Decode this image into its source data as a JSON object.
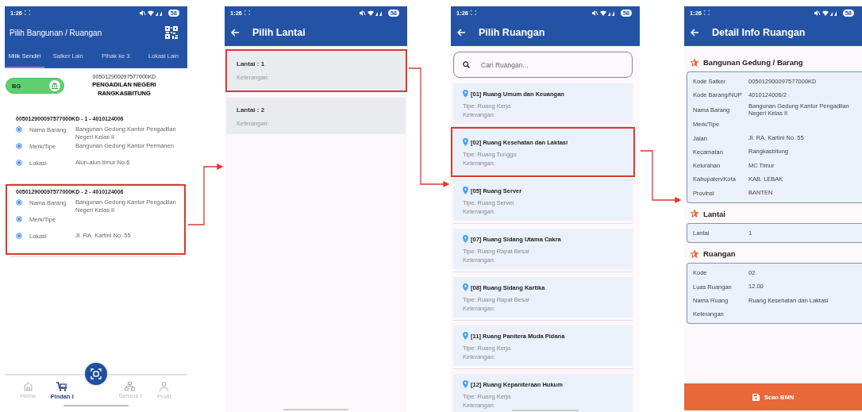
{
  "screens": [
    {
      "kind": "assets",
      "status": {
        "time": "1:26",
        "battery": "58"
      },
      "title": "Pilih Bangunan / Ruangan",
      "tabs": [
        {
          "label": "Milik Sendiri",
          "selected": true
        },
        {
          "label": "Satker Lain",
          "selected": false
        },
        {
          "label": "Pihak ke 3",
          "selected": false
        },
        {
          "label": "Lokasi Lain",
          "selected": false
        }
      ],
      "toggle": {
        "label": "BG",
        "on": true
      },
      "satker": {
        "code": "005012900097577000KD",
        "name": "PENGADILAN NEGERI RANGKASBITUNG"
      },
      "items": [
        {
          "title": "005012900097577000KD - 1 - 4010124006",
          "highlighted": false,
          "fields": [
            {
              "label": "Nama Barang",
              "value": "Bangunan Gedung Kantor Pengadilan Negeri Kelas II"
            },
            {
              "label": "Merk/Tipe",
              "value": "Bangunan Gedung Kantor Permanen"
            },
            {
              "label": "Lokasi",
              "value": "Alun-alun timur No.6"
            }
          ]
        },
        {
          "title": "005012900097577000KD - 2 - 4010124006",
          "highlighted": true,
          "fields": [
            {
              "label": "Nama Barang",
              "value": "Bangunan Gedung Kantor Pengadilan Negeri Kelas II"
            },
            {
              "label": "Merk/Tipe"
            },
            {
              "label": "Lokasi",
              "value": "Jl. RA. Kartini No. 55"
            }
          ]
        }
      ],
      "nav": [
        {
          "label": "Home",
          "selected": false,
          "kind": "home"
        },
        {
          "label": "Pindah I",
          "selected": true,
          "kind": "cart"
        },
        {
          "label": "Sensus I",
          "selected": false,
          "kind": "tree"
        },
        {
          "label": "Profil",
          "selected": false,
          "kind": "person"
        }
      ]
    },
    {
      "kind": "floors",
      "status": {
        "time": "1:26",
        "battery": "58"
      },
      "title": "Pilih Lantai",
      "floors": [
        {
          "name": "Lantai : 1",
          "note": "Keterangan:",
          "highlighted": true
        },
        {
          "name": "Lantai : 2",
          "note": "Keterangan:",
          "highlighted": false
        }
      ]
    },
    {
      "kind": "rooms",
      "status": {
        "time": "1:26",
        "battery": "58"
      },
      "title": "Pilih Ruangan",
      "search": {
        "placeholder": "Cari Ruangan..."
      },
      "rooms": [
        {
          "name": "[01] Ruang Umum dan Keuangan",
          "type": "Tipe: Ruang Kerja",
          "note": "Keterangan:",
          "highlighted": false
        },
        {
          "name": "[02] Ruang Kesehatan dan Laktasi",
          "type": "Tipe: Ruang Tunggu",
          "note": "Keterangan:",
          "highlighted": true
        },
        {
          "name": "[05] Ruang Server",
          "type": "Tipe: Ruang Server",
          "note": "Keterangan:",
          "highlighted": false
        },
        {
          "name": "[07] Ruang Sidang Utama Cakra",
          "type": "Tipe: Ruang Rapat Besar",
          "note": "Keterangan:",
          "highlighted": false
        },
        {
          "name": "[08] Ruang Sidang Kartika",
          "type": "Tipe: Ruang Rapat Besar",
          "note": "Keterangan:",
          "highlighted": false
        },
        {
          "name": "[11] Ruang Panitera Muda Pidana",
          "type": "Tipe: Ruang Kerja",
          "note": "Keterangan:",
          "highlighted": false
        },
        {
          "name": "[12] Ruang Kepaniteraan Hukum",
          "type": "Tipe: Ruang Kerja",
          "note": "Keterangan:",
          "highlighted": false
        }
      ]
    },
    {
      "kind": "detail",
      "status": {
        "time": "1:26",
        "battery": "58"
      },
      "title": "Detail Info Ruangan",
      "sections": [
        {
          "heading": "Bangunan Gedung / Barang",
          "rows": [
            {
              "label": "Kode Satker",
              "value": "005012900097577000KD"
            },
            {
              "label": "Kode Barang/NUP",
              "value": "4010124006/2"
            },
            {
              "label": "Nama Barang",
              "value": "Bangunan Gedung Kantor Pengadilan Negeri Kelas II"
            },
            {
              "label": "Merk/Tipe"
            },
            {
              "label": "Jalan",
              "value": "Jl. RA. Kartini No. 55"
            },
            {
              "label": "Kecamatan",
              "value": "Rangkasbitung"
            },
            {
              "label": "Kelurahan",
              "value": "MC Timur"
            },
            {
              "label": "Kabupaten/Kota",
              "value": "KAB. LEBAK"
            },
            {
              "label": "Provinsi",
              "value": "BANTEN"
            }
          ]
        },
        {
          "heading": "Lantai",
          "rows": [
            {
              "label": "Lantai",
              "value": "1"
            }
          ]
        },
        {
          "heading": "Ruangan",
          "rows": [
            {
              "label": "Kode",
              "value": "02"
            },
            {
              "label": "Luas Ruangan",
              "value": "12.00"
            },
            {
              "label": "Nama Ruang",
              "value": "Ruang Kesehatan dan Laktasi"
            },
            {
              "label": "Keterangan"
            }
          ]
        }
      ],
      "button": "Scan BMN"
    }
  ]
}
